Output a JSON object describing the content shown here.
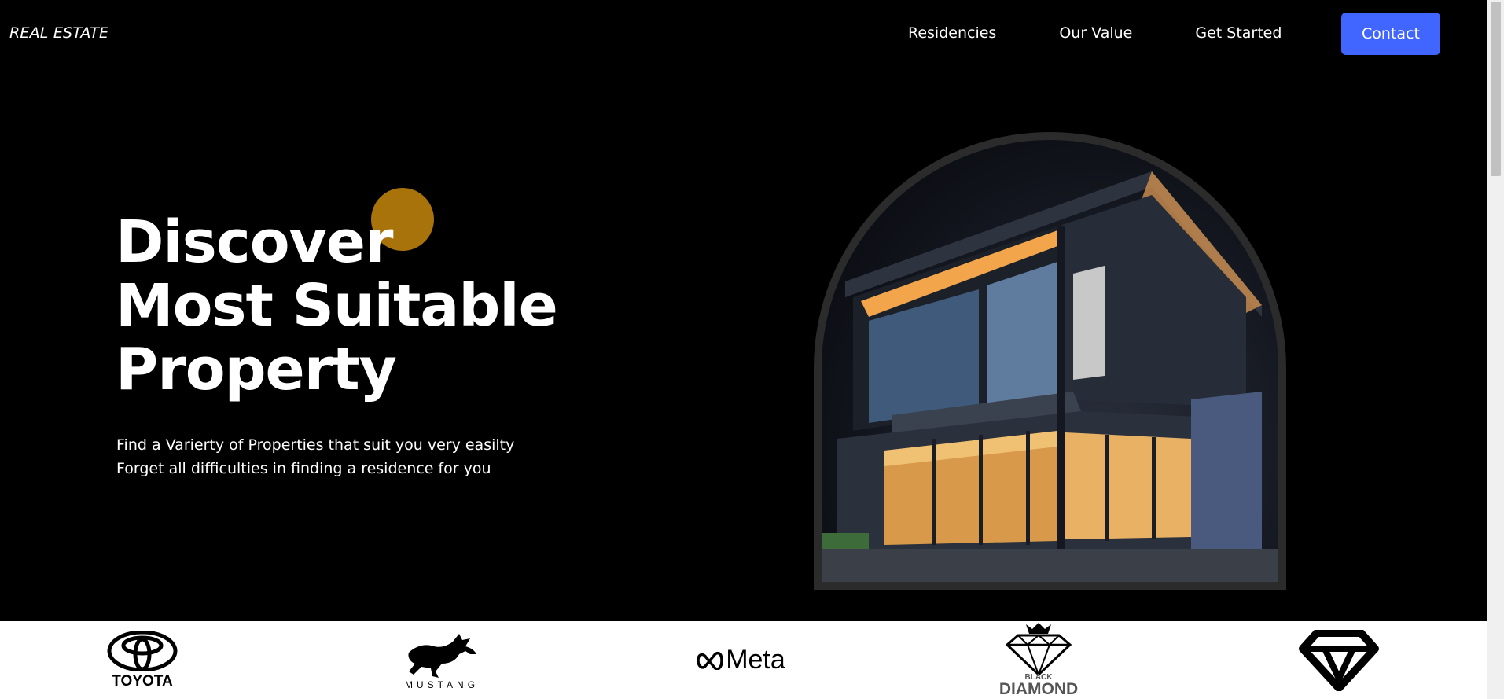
{
  "header": {
    "brand": "REAL ESTATE",
    "nav": [
      {
        "label": "Residencies"
      },
      {
        "label": "Our Value"
      },
      {
        "label": "Get Started"
      }
    ],
    "contact_label": "Contact"
  },
  "hero": {
    "title_lines": [
      "Discover",
      "Most Suitable",
      "Property"
    ],
    "subtitle_lines": [
      "Find a Varierty of Properties that suit you very easilty",
      "Forget all difficulties in finding a residence for you"
    ],
    "accent_color": "#a8730a"
  },
  "logos": [
    {
      "name": "toyota",
      "text": "TOYOTA"
    },
    {
      "name": "mustang",
      "text": "MUSTANG"
    },
    {
      "name": "meta",
      "text": "Meta"
    },
    {
      "name": "black-diamond",
      "text_top": "BLACK",
      "text_bottom": "DIAMOND"
    },
    {
      "name": "diamond",
      "text": ""
    }
  ],
  "colors": {
    "background": "#000000",
    "primary_button": "#4066ff",
    "accent_orb": "#a8730a"
  }
}
